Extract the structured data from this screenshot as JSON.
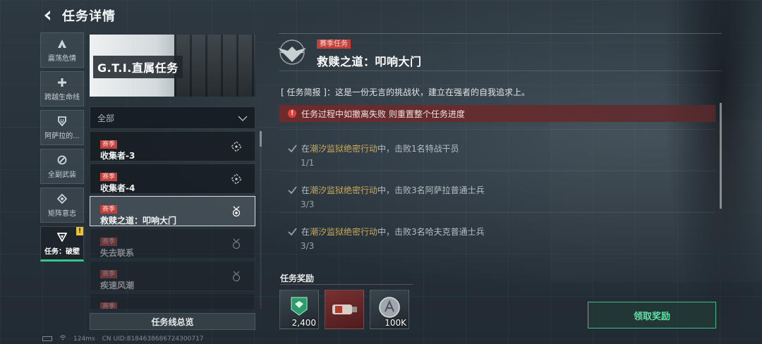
{
  "header": {
    "title": "任务详情"
  },
  "sidebar": {
    "items": [
      {
        "label": "震荡危情",
        "icon": "triangle-a-icon",
        "active": false
      },
      {
        "label": "跨越生命线",
        "icon": "plus-icon",
        "active": false
      },
      {
        "label": "阿萨拉的...",
        "icon": "shield-icon",
        "active": false
      },
      {
        "label": "全副武装",
        "icon": "slash-circle-icon",
        "active": false
      },
      {
        "label": "矩阵意志",
        "icon": "diamond-icon",
        "active": false
      },
      {
        "label": "任务：破壁",
        "icon": "down-triangle-icon",
        "active": true,
        "badge": "!"
      }
    ]
  },
  "banner": {
    "title": "G.T.I.直属任务"
  },
  "filter": {
    "label": "全部"
  },
  "tasks": [
    {
      "tag": "赛季",
      "name": "收集者-3",
      "icon": "target-icon",
      "state": "normal"
    },
    {
      "tag": "赛季",
      "name": "收集者-4",
      "icon": "target-icon",
      "state": "normal"
    },
    {
      "tag": "赛季",
      "name": "救赎之道：叩响大门",
      "icon": "medal-icon",
      "state": "selected"
    },
    {
      "tag": "赛季",
      "name": "失去联系",
      "icon": "medal-icon",
      "state": "dim"
    },
    {
      "tag": "赛季",
      "name": "疾速风潮",
      "icon": "medal-icon",
      "state": "dim"
    },
    {
      "tag": "赛季",
      "name": "",
      "icon": "medal-icon",
      "state": "dim"
    }
  ],
  "overview_button": "任务线总览",
  "detail": {
    "tag": "赛季任务",
    "title": "救赎之道：叩响大门",
    "brief": "[ 任务简报 ]：这是一份无言的挑战状，建立在强者的自我追求上。",
    "warning": "任务过程中如撤离失败 则重置整个任务进度",
    "objectives": [
      {
        "prefix": "在",
        "location": "潮汐监狱绝密行动",
        "suffix": "中，击败1名特战干员",
        "progress": "1/1"
      },
      {
        "prefix": "在",
        "location": "潮汐监狱绝密行动",
        "suffix": "中，击败3名阿萨拉普通士兵",
        "progress": "3/3"
      },
      {
        "prefix": "在",
        "location": "潮汐监狱绝密行动",
        "suffix": "中，击败3名哈夫克普通士兵",
        "progress": "3/3"
      }
    ]
  },
  "rewards": {
    "title": "任务奖励",
    "items": [
      {
        "icon": "green-badge-icon",
        "count": "2,400"
      },
      {
        "icon": "red-device-icon",
        "count": ""
      },
      {
        "icon": "silver-coin-icon",
        "count": "100K"
      }
    ]
  },
  "claim_button": "领取奖励",
  "status_bar": {
    "ping": "124ms",
    "uid": "CN UID:8184638686724300717"
  },
  "colors": {
    "accent_green": "#3fbf86",
    "season_red": "#c33f3a",
    "highlight_gold": "#c8a85a"
  }
}
